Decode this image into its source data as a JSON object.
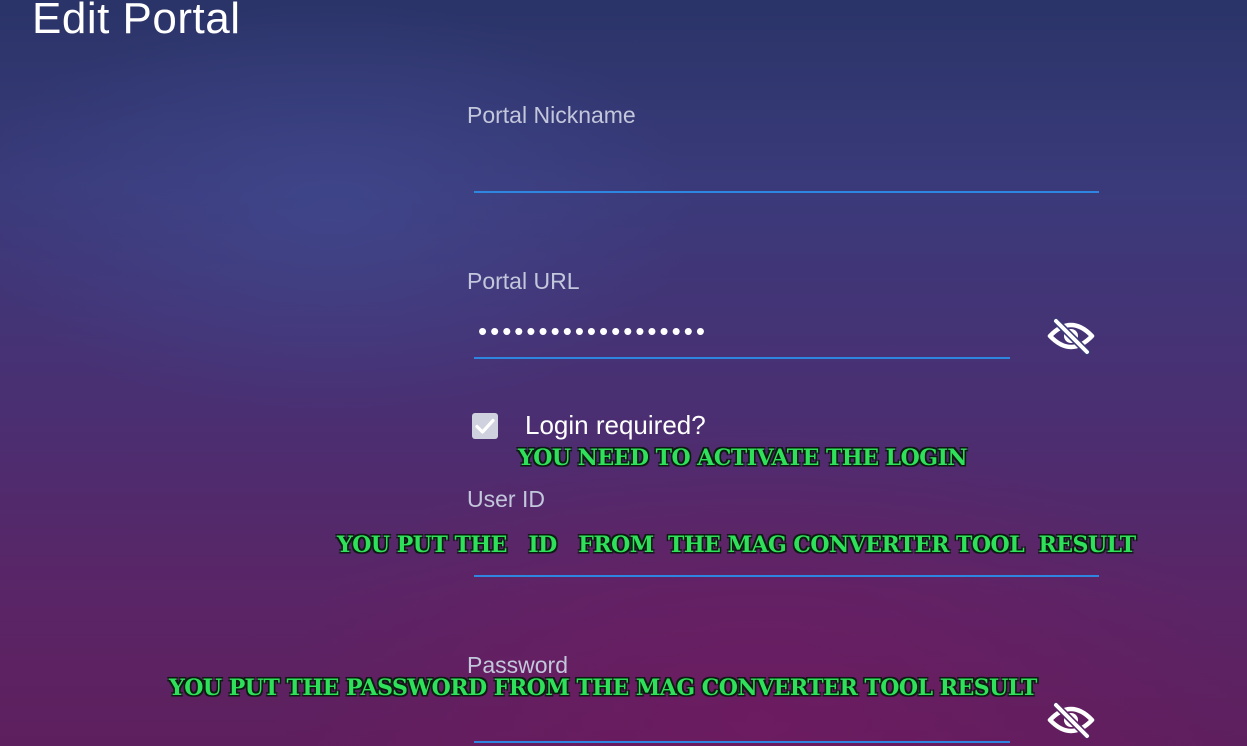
{
  "page": {
    "title": "Edit Portal"
  },
  "form": {
    "nickname": {
      "label": "Portal Nickname",
      "value": ""
    },
    "url": {
      "label": "Portal URL",
      "masked_value": "•••••••••••••••••••",
      "visibility_icon": "eye-off-icon"
    },
    "login_required": {
      "label": "Login required?",
      "checked": true
    },
    "user_id": {
      "label": "User ID",
      "value": ""
    },
    "password": {
      "label": "Password",
      "value": "",
      "visibility_icon": "eye-off-icon"
    }
  },
  "annotations": {
    "login": "YOU NEED TO ACTIVATE THE LOGIN",
    "user_id": "YOU PUT THE   ID   FROM  THE MAG CONVERTER TOOL  RESULT",
    "password": "YOU PUT THE PASSWORD FROM THE MAG CONVERTER TOOL RESULT"
  },
  "colors": {
    "accent_underline": "#2f86e0",
    "annotation_green": "#2fe15a"
  }
}
